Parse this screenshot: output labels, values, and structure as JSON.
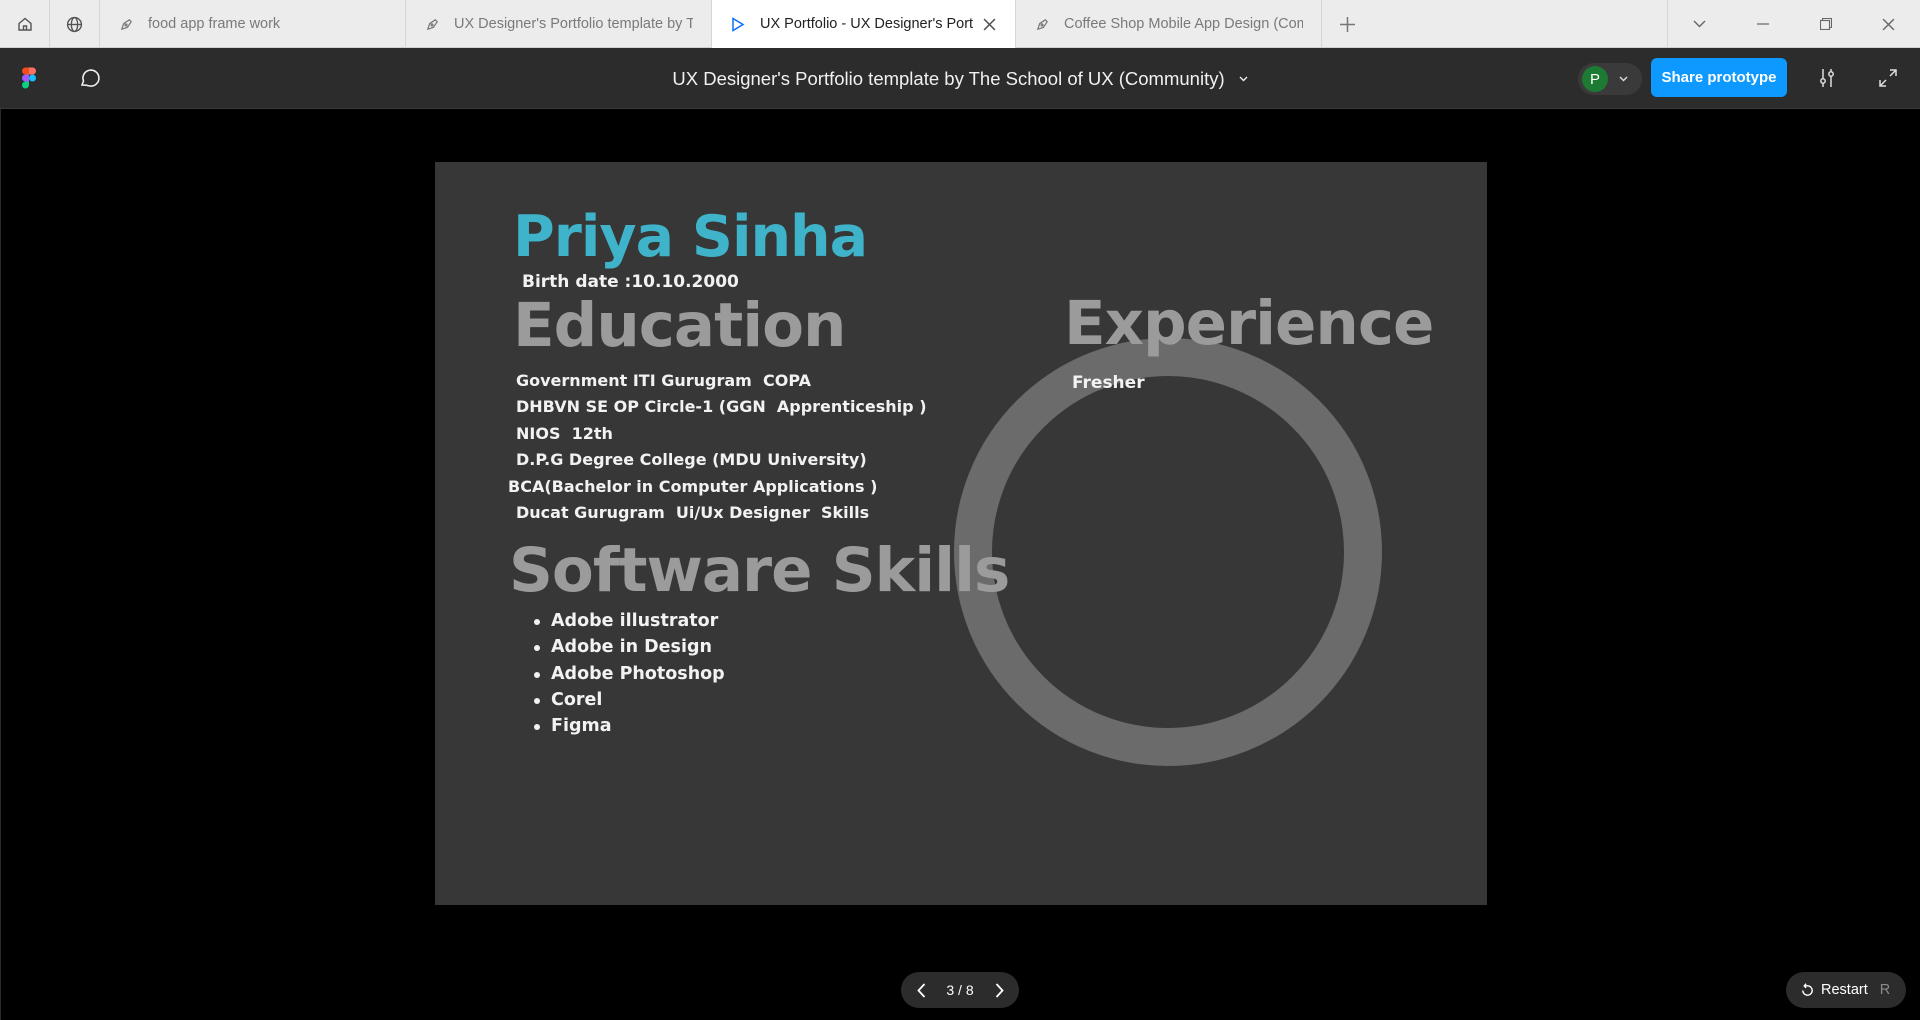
{
  "browser": {
    "tabs": [
      {
        "label": "food app frame work",
        "icon": "figma-file-icon",
        "active": false
      },
      {
        "label": "UX Designer's Portfolio template by T",
        "icon": "figma-file-icon",
        "active": false
      },
      {
        "label": "UX Portfolio - UX Designer's Port",
        "icon": "play-icon",
        "active": true
      },
      {
        "label": "Coffee Shop Mobile App Design (Com",
        "icon": "figma-file-icon",
        "active": false
      }
    ]
  },
  "toolbar": {
    "file_title": "UX Designer's Portfolio template by The School of UX (Community)",
    "avatar_initial": "P",
    "share_label": "Share prototype"
  },
  "slide": {
    "name": "Priya Sinha",
    "birth_date": "Birth date :10.10.2000",
    "education_heading": "Education",
    "education_items": [
      "Government ITI Gurugram  COPA",
      "DHBVN SE OP Circle-1 (GGN  Apprenticeship )",
      "NIOS  12th",
      "D.P.G Degree College (MDU University)",
      "BCA(Bachelor in Computer Applications )",
      "Ducat Gurugram  Ui/Ux Designer  Skills"
    ],
    "experience_heading": "Experience",
    "experience_text": "Fresher",
    "software_heading": "Software Skills",
    "software_items": [
      "Adobe illustrator",
      "Adobe in Design",
      "Adobe Photoshop",
      "Corel",
      "Figma"
    ]
  },
  "footer": {
    "page_indicator": "3 / 8",
    "restart_label": "Restart",
    "restart_key": "R"
  },
  "colors": {
    "accent": "#0d99ff",
    "name_color": "#3fb3c9",
    "heading_color": "#9b9b9b",
    "frame_bg": "#373737"
  }
}
